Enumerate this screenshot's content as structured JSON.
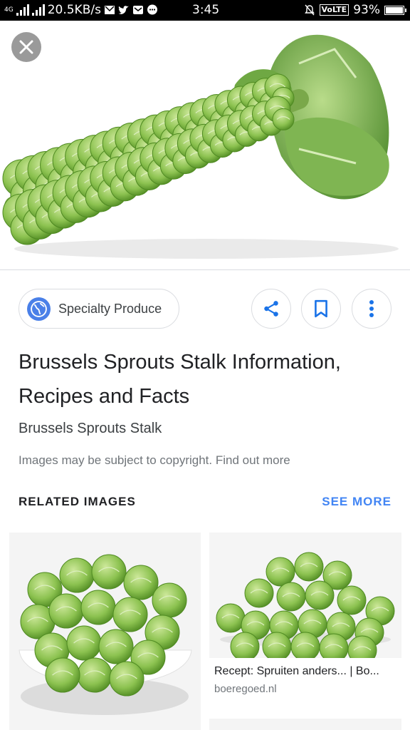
{
  "status_bar": {
    "network": "4G",
    "speed": "20.5KB/s",
    "time": "3:45",
    "volte": "VoLTE",
    "battery": "93%",
    "battery_level": 0.93,
    "notification_icons": [
      "sms-icon",
      "twitter-icon",
      "mail-icon",
      "chat-icon"
    ]
  },
  "viewer": {
    "close_icon": "close-icon",
    "source": {
      "name": "Specialty Produce",
      "icon": "globe-icon"
    },
    "actions": [
      "share-icon",
      "bookmark-icon",
      "more-vert-icon"
    ],
    "title": "Brussels Sprouts Stalk Information, Recipes and Facts",
    "subtitle": "Brussels Sprouts Stalk",
    "copyright_text": "Images may be subject to copyright.",
    "copyright_link": "Find out more"
  },
  "related": {
    "heading": "RELATED IMAGES",
    "see_more": "SEE MORE",
    "items": [
      {
        "title": "",
        "source": ""
      },
      {
        "title": "Recept: Spruiten anders... | Bo...",
        "source": "boeregoed.nl"
      }
    ]
  },
  "colors": {
    "accent": "#4285f4",
    "globe": "#4a80e8",
    "sprout_light": "#a9d468",
    "sprout_dark": "#5a9a2a"
  }
}
